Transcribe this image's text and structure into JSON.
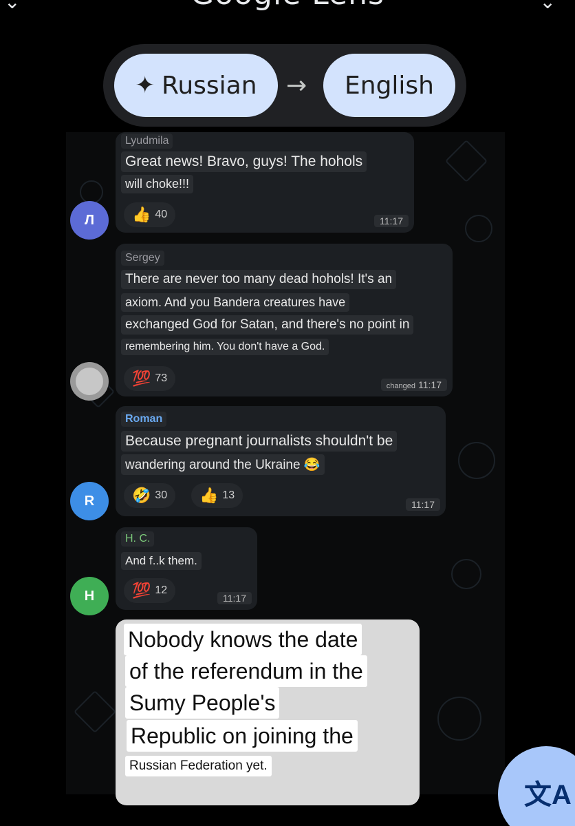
{
  "header": {
    "app_title": "Google Lens"
  },
  "language_selector": {
    "source_language": "Russian",
    "target_language": "English",
    "sparkle_icon": "sparkle-icon",
    "arrow_icon": "arrow-right-icon"
  },
  "messages": [
    {
      "avatar_letter": "Л",
      "avatar_color": "#5c6bd6",
      "sender": "Lyudmila",
      "sender_color": "#9a9aa0",
      "lines": [
        "Great news! Bravo, guys! The hohols",
        "will choke!!!"
      ],
      "reactions": [
        {
          "emoji": "👍",
          "count": "40"
        }
      ],
      "time": "11:17",
      "time_prefix": ""
    },
    {
      "avatar_letter": "",
      "avatar_color": "#9a9a9a",
      "sender": "Sergey",
      "sender_color": "#9a9aa0",
      "lines": [
        "There are never too many dead hohols! It's an",
        "axiom. And you Bandera creatures have",
        "exchanged God for Satan, and there's no point in",
        "remembering him. You don't have a God."
      ],
      "reactions": [
        {
          "emoji": "💯",
          "count": "73"
        }
      ],
      "time": "11:17",
      "time_prefix": "changed"
    },
    {
      "avatar_letter": "R",
      "avatar_color": "#3d8ee6",
      "sender": "Roman",
      "sender_color": "#6aa9f0",
      "lines": [
        "Because pregnant journalists shouldn't be",
        "wandering around the Ukraine 😂"
      ],
      "reactions": [
        {
          "emoji": "🤣",
          "count": "30"
        },
        {
          "emoji": "👍",
          "count": "13"
        }
      ],
      "time": "11:17",
      "time_prefix": ""
    },
    {
      "avatar_letter": "H",
      "avatar_color": "#3fae55",
      "sender": "H. C.",
      "sender_color": "#7cc97a",
      "lines": [
        "And f..k them."
      ],
      "reactions": [
        {
          "emoji": "💯",
          "count": "12"
        }
      ],
      "time": "11:17",
      "time_prefix": ""
    }
  ],
  "translated_overlay": {
    "lines": [
      "Nobody knows the date",
      "of the referendum in the",
      "Sumy People's",
      "Republic on joining the",
      "Russian Federation yet."
    ]
  },
  "fab": {
    "icon": "translate-icon",
    "glyph": "文A"
  }
}
